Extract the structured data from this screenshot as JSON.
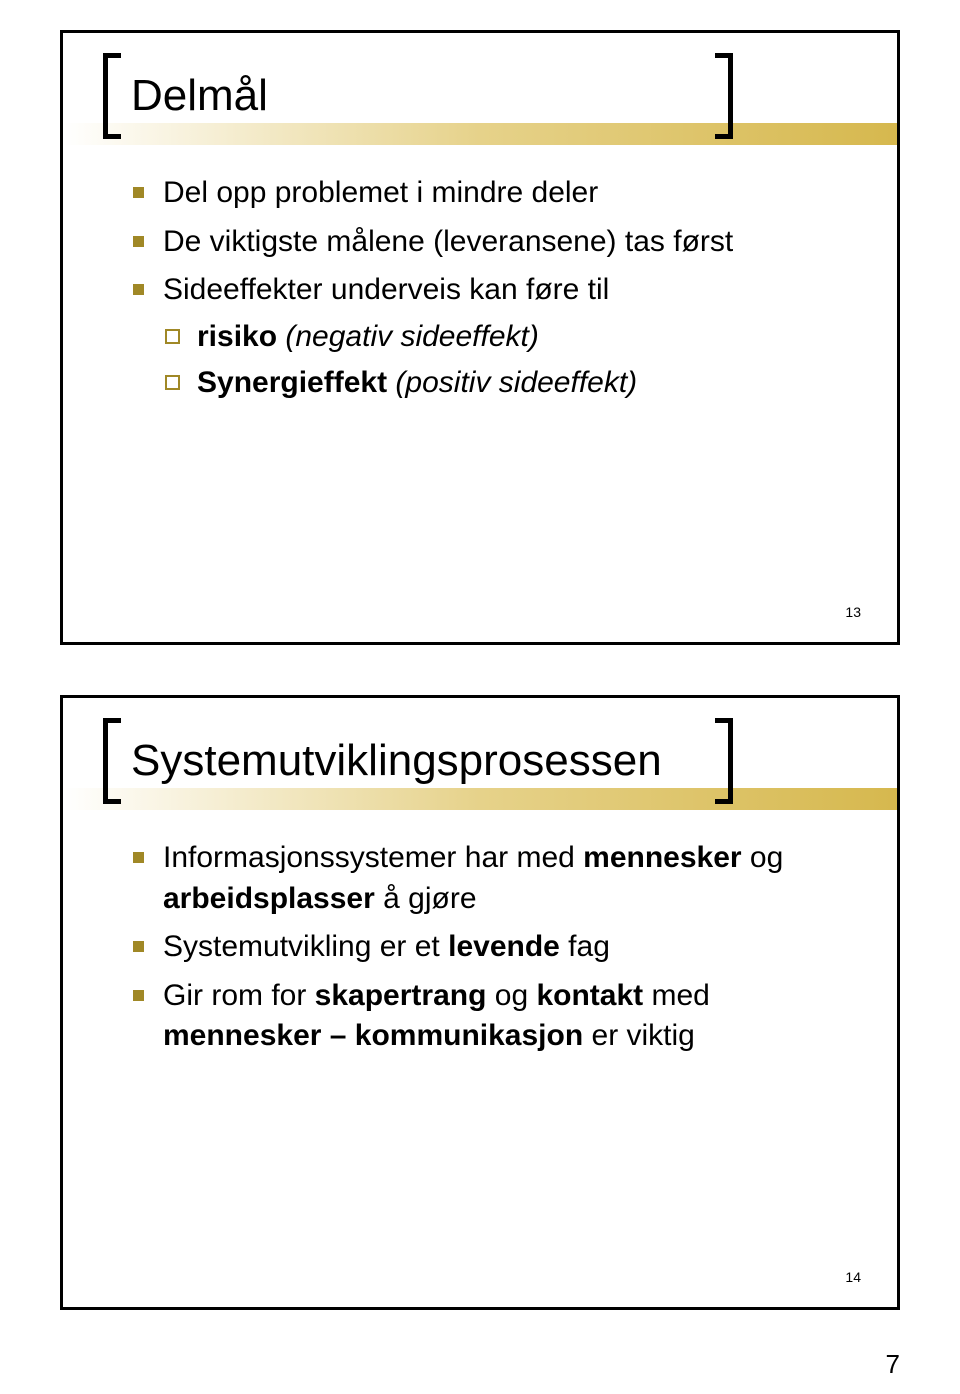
{
  "page_number": "7",
  "slide1": {
    "title": "Delmål",
    "slide_number": "13",
    "bullets": [
      {
        "text": "Del opp problemet i mindre deler"
      },
      {
        "text": "De viktigste målene (leveransene) tas først"
      },
      {
        "text": "Sideeffekter underveis kan føre til",
        "sub": [
          {
            "bold": "risiko",
            "italic": " (negativ sideeffekt)"
          },
          {
            "bold": "Synergieffekt",
            "italic": " (positiv sideeffekt)"
          }
        ]
      }
    ]
  },
  "slide2": {
    "title": "Systemutviklingsprosessen",
    "slide_number": "14",
    "bullets": [
      {
        "parts": [
          {
            "t": "Informasjonssystemer har med "
          },
          {
            "t": "mennesker",
            "b": true
          },
          {
            "t": " og "
          },
          {
            "t": "arbeidsplasser",
            "b": true
          },
          {
            "t": " å gjøre"
          }
        ]
      },
      {
        "parts": [
          {
            "t": "Systemutvikling er et "
          },
          {
            "t": "levende",
            "b": true
          },
          {
            "t": " fag"
          }
        ]
      },
      {
        "parts": [
          {
            "t": "Gir rom for "
          },
          {
            "t": "skapertrang",
            "b": true
          },
          {
            "t": " og "
          },
          {
            "t": "kontakt",
            "b": true
          },
          {
            "t": " med "
          },
          {
            "t": "mennesker – kommunikasjon",
            "b": true
          },
          {
            "t": " er viktig"
          }
        ]
      }
    ]
  }
}
